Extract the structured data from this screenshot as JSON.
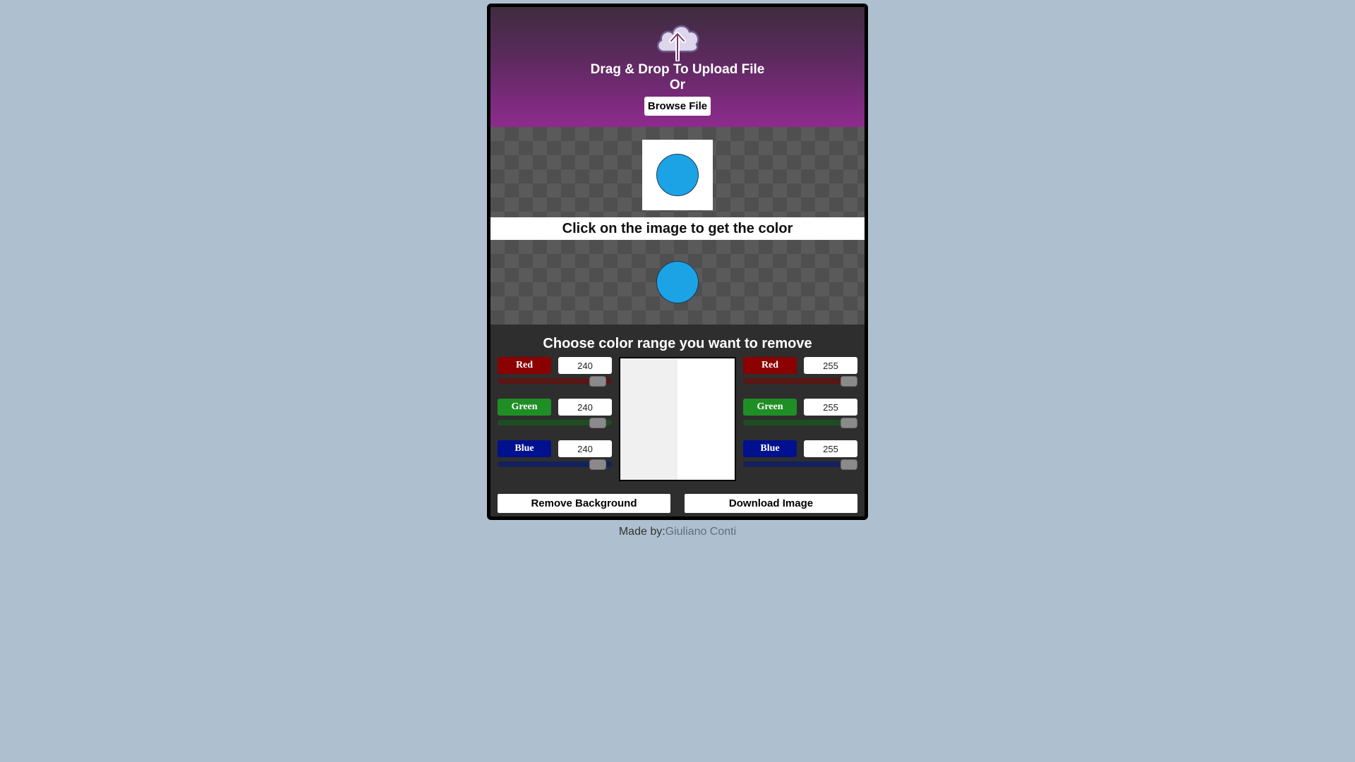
{
  "upload": {
    "title": "Drag & Drop To Upload File",
    "or_text": "Or",
    "browse_label": "Browse File",
    "icon": "cloud-upload-icon"
  },
  "preview": {
    "circle_color": "#1ca3e6"
  },
  "click_banner": "Click on the image to get the color",
  "result": {
    "circle_color": "#1ca3e6"
  },
  "range": {
    "title": "Choose color range you want to remove",
    "min": {
      "red": {
        "label": "Red",
        "value": "240"
      },
      "green": {
        "label": "Green",
        "value": "240"
      },
      "blue": {
        "label": "Blue",
        "value": "240"
      }
    },
    "max": {
      "red": {
        "label": "Red",
        "value": "255"
      },
      "green": {
        "label": "Green",
        "value": "255"
      },
      "blue": {
        "label": "Blue",
        "value": "255"
      }
    },
    "swatch_min_color": "#f0f0f0",
    "swatch_max_color": "#ffffff"
  },
  "actions": {
    "remove_label": "Remove Background",
    "download_label": "Download Image"
  },
  "footer": {
    "made_by": "Made by:",
    "author": "Giuliano Conti"
  },
  "colors": {
    "page_bg": "#aebfcf",
    "red": "#8b0000",
    "green": "#1f8f25",
    "blue": "#00118f"
  }
}
